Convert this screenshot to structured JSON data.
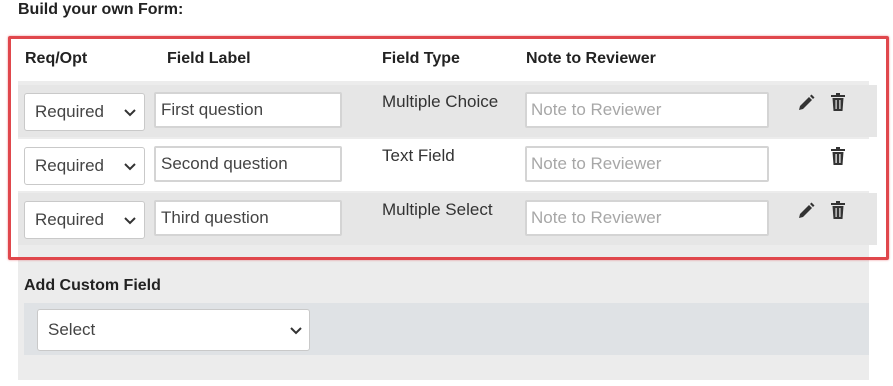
{
  "page": {
    "title": "Build your own Form:"
  },
  "table": {
    "headers": {
      "req_opt": "Req/Opt",
      "field_label": "Field Label",
      "field_type": "Field Type",
      "note": "Note to Reviewer"
    },
    "rows": [
      {
        "requirement": "Required",
        "label": "First question",
        "type": "Multiple Choice",
        "note_placeholder": "Note to Reviewer",
        "editable": true,
        "edit_icon": "pencil-icon",
        "delete_icon": "trash-icon"
      },
      {
        "requirement": "Required",
        "label": "Second question",
        "type": "Text Field",
        "note_placeholder": "Note to Reviewer",
        "editable": false,
        "delete_icon": "trash-icon"
      },
      {
        "requirement": "Required",
        "label": "Third question",
        "type": "Multiple Select",
        "note_placeholder": "Note to Reviewer",
        "editable": true,
        "edit_icon": "pencil-icon",
        "delete_icon": "trash-icon"
      }
    ]
  },
  "custom_field": {
    "label": "Add Custom Field",
    "select_value": "Select"
  },
  "colors": {
    "highlight_border": "#e0474c",
    "panel_bg": "#ececec",
    "row_grey": "#e6e6e6"
  }
}
